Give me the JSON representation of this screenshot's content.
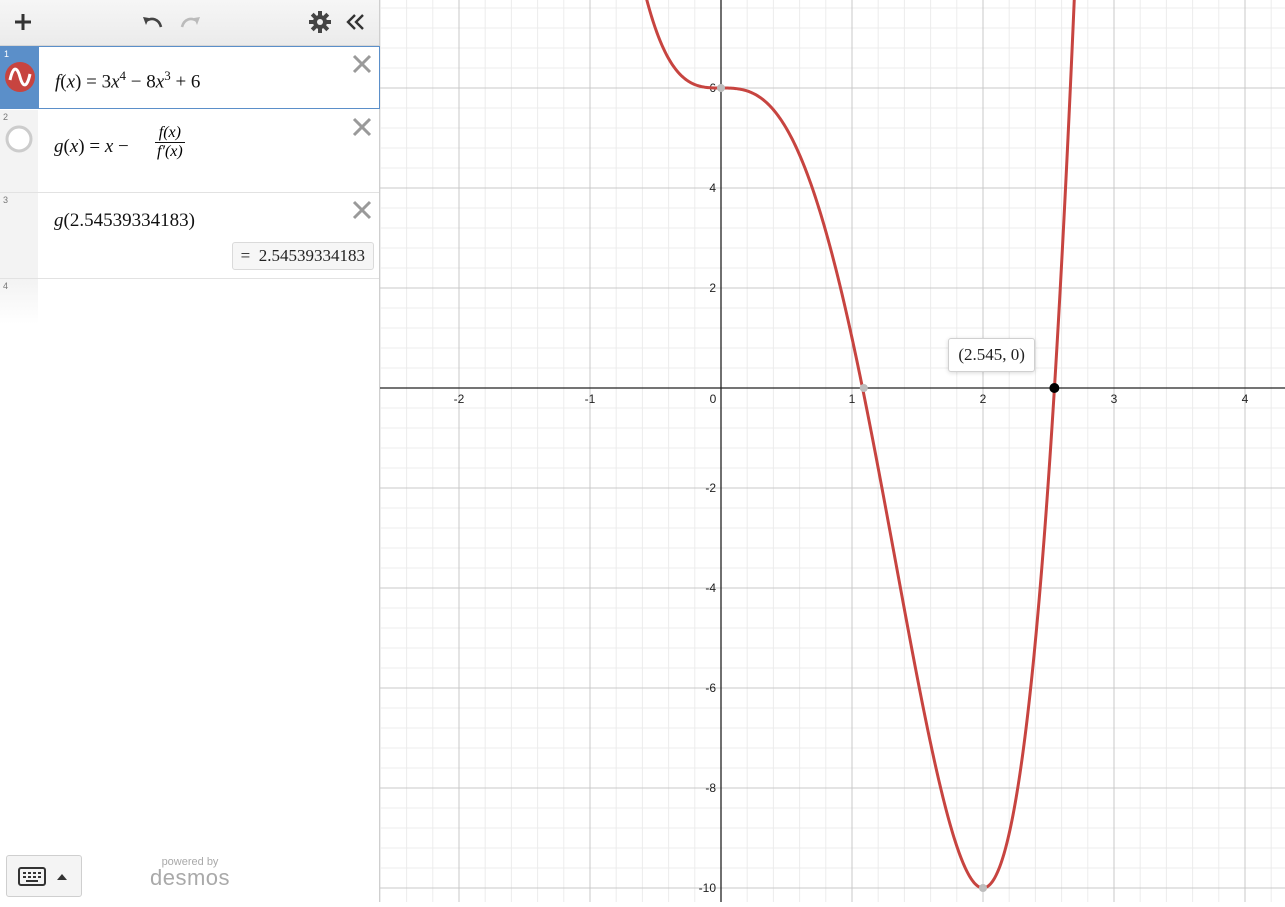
{
  "toolbar": {
    "add_icon": "plus-icon",
    "undo_icon": "undo-icon",
    "redo_icon": "redo-icon",
    "settings_icon": "gear-icon",
    "collapse_icon": "double-chevron-left-icon"
  },
  "expressions": [
    {
      "index": "1",
      "name_f": "f",
      "x": "x",
      "equals": "=",
      "coef1": "3",
      "var1": "x",
      "exp1": "4",
      "op1": "−",
      "coef2": "8",
      "var2": "x",
      "exp2": "3",
      "op2": "+",
      "const": "6"
    },
    {
      "index": "2",
      "lhs": "g",
      "x": "x",
      "equals": "=",
      "x2": "x",
      "minus": "−",
      "num": "f(x)",
      "den": "f′(x)"
    },
    {
      "index": "3",
      "fn": "g",
      "arg": "2.54539334183",
      "result_eq": "=",
      "result": "2.54539334183"
    },
    {
      "index": "4"
    }
  ],
  "footer": {
    "powered_by": "powered by",
    "brand": "desmos",
    "keyboard_icon": "keyboard-icon",
    "caret_icon": "caret-up-icon"
  },
  "graph": {
    "curve_color": "#c74440",
    "x_ticks": [
      "-2",
      "-1",
      "0",
      "1",
      "2",
      "3",
      "4"
    ],
    "y_ticks": [
      "6",
      "4",
      "2",
      "-2",
      "-4",
      "-6",
      "-8",
      "-10"
    ],
    "point_label": "(2.545, 0)",
    "point": {
      "x": 2.545,
      "y": 0
    },
    "grey_points": [
      {
        "x": 0,
        "y": 6
      },
      {
        "x": 1.09,
        "y": 0
      },
      {
        "x": 2,
        "y": -10
      }
    ],
    "function": "f(x) = 3x^4 - 8x^3 + 6"
  }
}
